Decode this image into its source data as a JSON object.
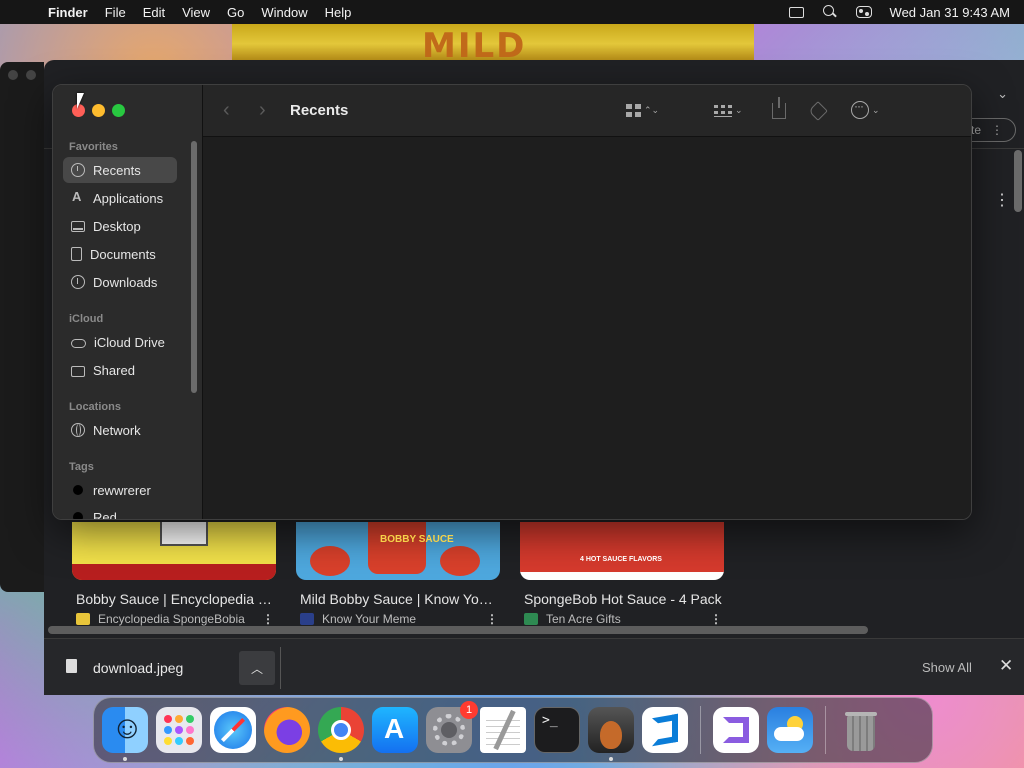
{
  "menubar": {
    "app_name": "Finder",
    "items": [
      "File",
      "Edit",
      "View",
      "Go",
      "Window",
      "Help"
    ],
    "datetime": "Wed Jan 31  9:43 AM"
  },
  "browser": {
    "partial_button": "te",
    "results": [
      {
        "title": "Bobby Sauce | Encyclopedia SpongeBob",
        "source": "Encyclopedia SpongeBobia",
        "thumb_text": ""
      },
      {
        "title": "Mild Bobby Sauce | Know Your Meme",
        "source": "Know Your Meme",
        "thumb_text": "BOBBY SAUCE"
      },
      {
        "title": "SpongeBob Hot Sauce - 4 Pack",
        "source": "Ten Acre Gifts",
        "thumb_text": "4 HOT SAUCE FLAVORS"
      }
    ],
    "download": {
      "filename": "download.jpeg",
      "show_all": "Show All"
    }
  },
  "finder": {
    "title": "Recents",
    "sidebar": {
      "favorites_label": "Favorites",
      "favorites": [
        "Recents",
        "Applications",
        "Desktop",
        "Documents",
        "Downloads"
      ],
      "icloud_label": "iCloud",
      "icloud": [
        "iCloud Drive",
        "Shared"
      ],
      "locations_label": "Locations",
      "locations": [
        "Network"
      ],
      "tags_label": "Tags",
      "tags": [
        {
          "label": "rewwrerer",
          "color": "#000000"
        },
        {
          "label": "Red",
          "color": "#000000"
        }
      ]
    }
  },
  "dock": {
    "apps": [
      "Finder",
      "Launchpad",
      "Safari",
      "Firefox",
      "Google Chrome",
      "App Store",
      "System Settings",
      "TextEdit",
      "Terminal",
      "GarageBand",
      "Visual Studio Code",
      "Visual Studio",
      "Weather",
      "Trash"
    ],
    "settings_badge": "1"
  }
}
